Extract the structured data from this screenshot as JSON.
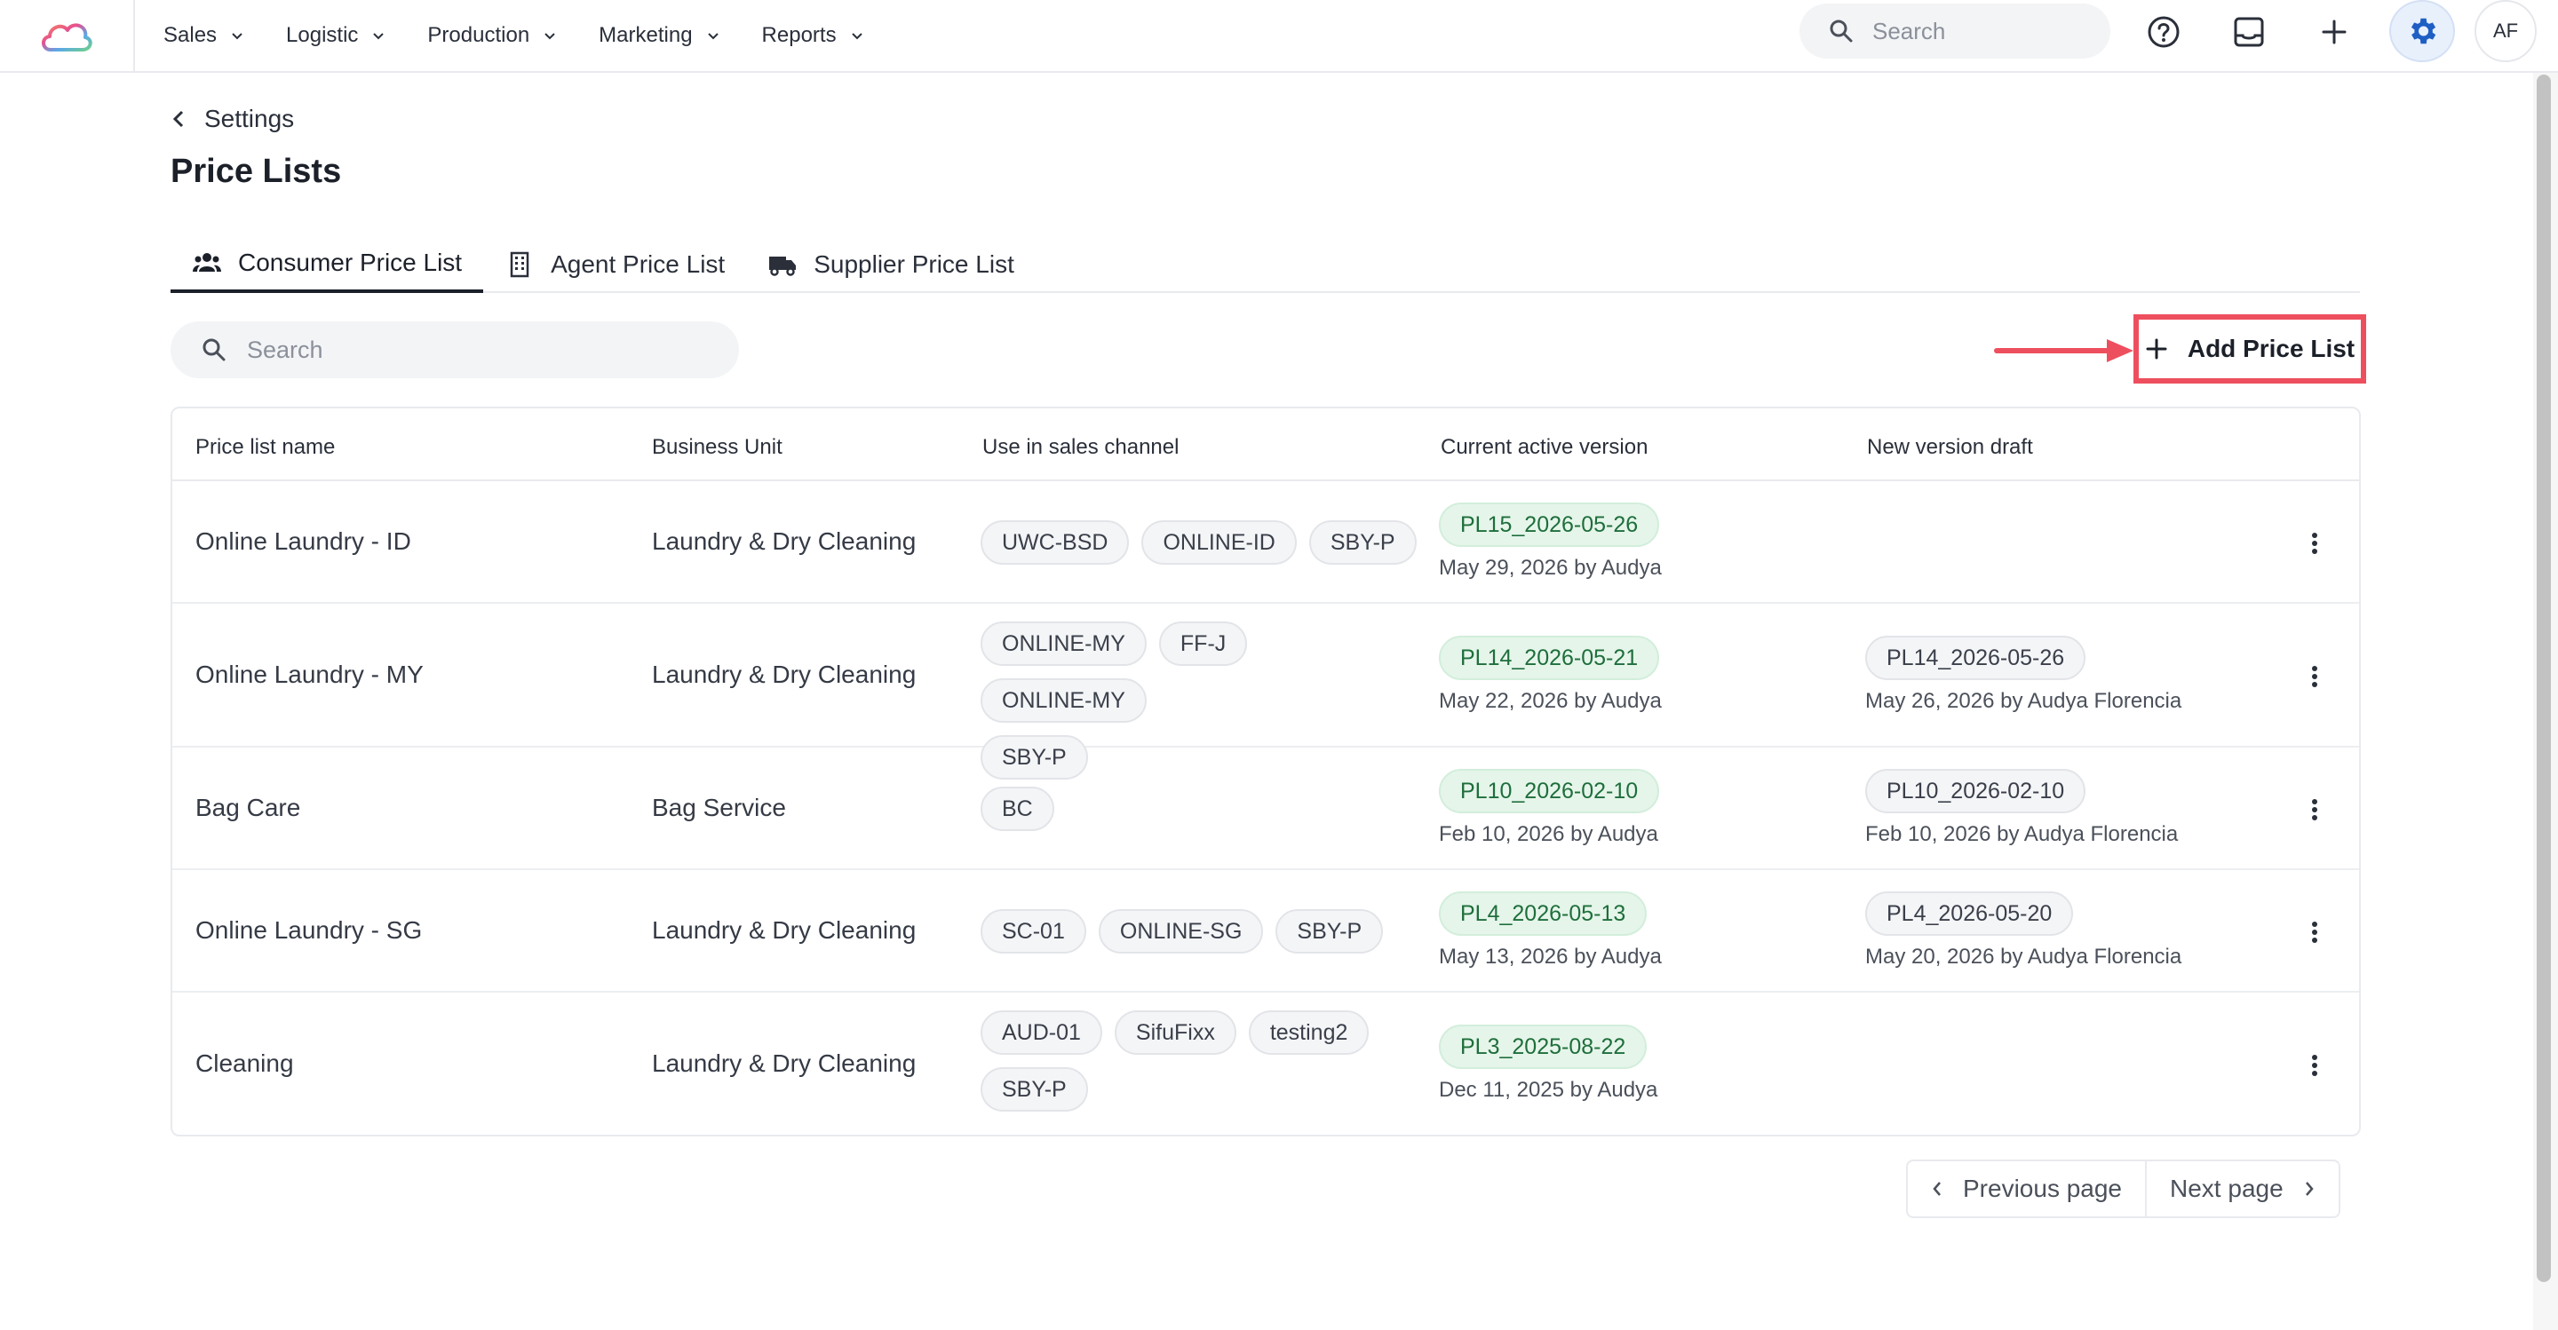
{
  "nav": {
    "items": [
      {
        "label": "Sales"
      },
      {
        "label": "Logistic"
      },
      {
        "label": "Production"
      },
      {
        "label": "Marketing"
      },
      {
        "label": "Reports"
      }
    ],
    "search_placeholder": "Search",
    "avatar_initials": "AF"
  },
  "breadcrumb": {
    "label": "Settings"
  },
  "page": {
    "title": "Price Lists"
  },
  "tabs": [
    {
      "label": "Consumer Price List",
      "active": true
    },
    {
      "label": "Agent Price List",
      "active": false
    },
    {
      "label": "Supplier Price List",
      "active": false
    }
  ],
  "toolbar": {
    "search_placeholder": "Search",
    "add_label": "Add Price List",
    "highlight_color": "#ee4f5e"
  },
  "table": {
    "headers": [
      "Price list name",
      "Business Unit",
      "Use in sales channel",
      "Current active version",
      "New version draft"
    ],
    "rows": [
      {
        "name": "Online Laundry - ID",
        "unit": "Laundry & Dry Cleaning",
        "channels": [
          "UWC-BSD",
          "ONLINE-ID",
          "SBY-P"
        ],
        "active": {
          "code": "PL15_2026-05-26",
          "meta": "May 29, 2026 by Audya"
        },
        "draft": null
      },
      {
        "name": "Online Laundry - MY",
        "unit": "Laundry & Dry Cleaning",
        "channels": [
          "ONLINE-MY",
          "FF-J",
          "ONLINE-MY",
          "SBY-P"
        ],
        "active": {
          "code": "PL14_2026-05-21",
          "meta": "May 22, 2026 by Audya"
        },
        "draft": {
          "code": "PL14_2026-05-26",
          "meta": "May 26, 2026 by Audya Florencia"
        }
      },
      {
        "name": "Bag Care",
        "unit": "Bag Service",
        "channels": [
          "BC"
        ],
        "active": {
          "code": "PL10_2026-02-10",
          "meta": "Feb 10, 2026 by Audya"
        },
        "draft": {
          "code": "PL10_2026-02-10",
          "meta": "Feb 10, 2026 by Audya Florencia"
        }
      },
      {
        "name": "Online Laundry - SG",
        "unit": "Laundry & Dry Cleaning",
        "channels": [
          "SC-01",
          "ONLINE-SG",
          "SBY-P"
        ],
        "active": {
          "code": "PL4_2026-05-13",
          "meta": "May 13, 2026 by Audya"
        },
        "draft": {
          "code": "PL4_2026-05-20",
          "meta": "May 20, 2026 by Audya Florencia"
        }
      },
      {
        "name": "Cleaning",
        "unit": "Laundry & Dry Cleaning",
        "channels": [
          "AUD-01",
          "SifuFixx",
          "testing2",
          "SBY-P"
        ],
        "active": {
          "code": "PL3_2025-08-22",
          "meta": "Dec 11, 2025 by Audya"
        },
        "draft": null
      }
    ]
  },
  "pagination": {
    "prev_label": "Previous page",
    "next_label": "Next page"
  }
}
